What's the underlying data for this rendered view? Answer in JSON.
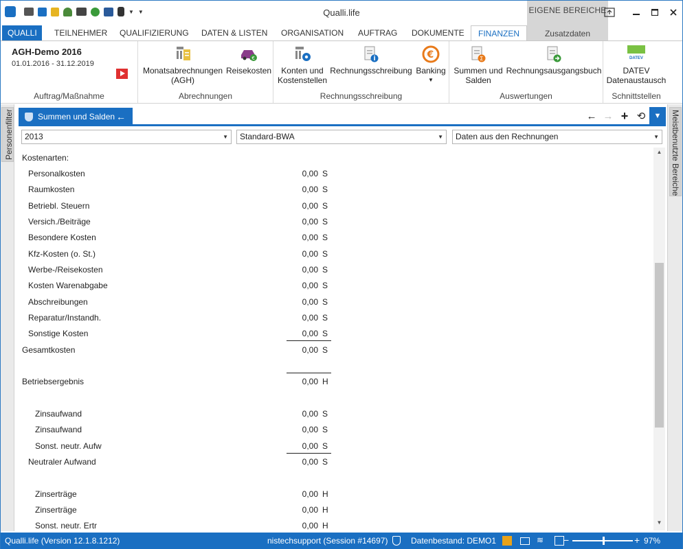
{
  "app_title": "Qualli.life",
  "eigene_bereiche": "EIGENE BEREICHE",
  "zusatzdaten": "Zusatzdaten",
  "tabs": [
    "QUALLI",
    "TEILNEHMER",
    "QUALIFIZIERUNG",
    "DATEN & LISTEN",
    "ORGANISATION",
    "AUFTRAG",
    "DOKUMENTE",
    "FINANZEN"
  ],
  "project": {
    "title": "AGH-Demo 2016",
    "dates": "01.01.2016 - 31.12.2019",
    "group": "Auftrag/Maßnahme"
  },
  "ribbon": {
    "abrechnungen": {
      "label": "Abrechnungen",
      "b1_l1": "Monatsabrechnungen",
      "b1_l2": "(AGH)",
      "b2": "Reisekosten"
    },
    "rechnungsschreibung": {
      "label": "Rechnungsschreibung",
      "b1_l1": "Konten und",
      "b1_l2": "Kostenstellen",
      "b2": "Rechnungsschreibung",
      "b3": "Banking"
    },
    "auswertungen": {
      "label": "Auswertungen",
      "b1_l1": "Summen und",
      "b1_l2": "Salden",
      "b2": "Rechnungsausgangsbuch"
    },
    "schnittstellen": {
      "label": "Schnittstellen",
      "b1_l1": "DATEV",
      "b1_l2": "Datenaustausch",
      "datev_logo": "DATEV"
    }
  },
  "left_panel": "Personenfilter",
  "right_panel": "Meistbenutzte Bereiche",
  "doc_tab": "Summen und Salden",
  "filters": {
    "year": "2013",
    "report": "Standard-BWA",
    "source": "Daten aus den Rechnungen"
  },
  "rows": [
    {
      "label": "Kostenarten:",
      "value": "",
      "sh": ""
    },
    {
      "label": "Personalkosten",
      "value": "0,00",
      "sh": "S"
    },
    {
      "label": "Raumkosten",
      "value": "0,00",
      "sh": "S"
    },
    {
      "label": "Betriebl. Steuern",
      "value": "0,00",
      "sh": "S"
    },
    {
      "label": "Versich./Beiträge",
      "value": "0,00",
      "sh": "S"
    },
    {
      "label": "Besondere Kosten",
      "value": "0,00",
      "sh": "S"
    },
    {
      "label": "Kfz-Kosten (o. St.)",
      "value": "0,00",
      "sh": "S"
    },
    {
      "label": "Werbe-/Reisekosten",
      "value": "0,00",
      "sh": "S"
    },
    {
      "label": "Kosten Warenabgabe",
      "value": "0,00",
      "sh": "S"
    },
    {
      "label": "Abschreibungen",
      "value": "0,00",
      "sh": "S"
    },
    {
      "label": "Reparatur/Instandh.",
      "value": "0,00",
      "sh": "S"
    },
    {
      "label": "Sonstige Kosten",
      "value": "0,00",
      "sh": "S"
    },
    {
      "label": "Gesamtkosten",
      "value": "0,00",
      "sh": "S"
    },
    {
      "label": "Betriebsergebnis",
      "value": "0,00",
      "sh": "H"
    },
    {
      "label": "Zinsaufwand",
      "value": "0,00",
      "sh": "S"
    },
    {
      "label": "Zinsaufwand",
      "value": "0,00",
      "sh": "S"
    },
    {
      "label": "Sonst. neutr. Aufw",
      "value": "0,00",
      "sh": "S"
    },
    {
      "label": "Neutraler Aufwand",
      "value": "0,00",
      "sh": "S"
    },
    {
      "label": "Zinserträge",
      "value": "0,00",
      "sh": "H"
    },
    {
      "label": "Zinserträge",
      "value": "0,00",
      "sh": "H"
    },
    {
      "label": "Sonst. neutr. Ertr",
      "value": "0,00",
      "sh": "H"
    }
  ],
  "status": {
    "version": "Qualli.life (Version 12.1.8.1212)",
    "session": "nistechsupport (Session #14697)",
    "datenbestand": "Datenbestand: DEMO1",
    "zoom": "97%"
  }
}
